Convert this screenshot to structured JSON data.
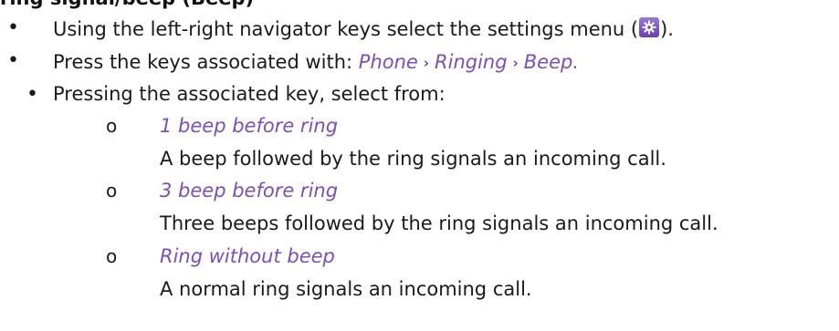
{
  "heading_fragment": "ring signal/beep (Beep)",
  "bullets": [
    {
      "pre": "Using the left-right navigator keys select the settings menu (",
      "post": ")."
    },
    {
      "pre": "Press the keys associated with: ",
      "path": [
        "Phone",
        "Ringing",
        "Beep"
      ],
      "post": "."
    },
    {
      "text": "Pressing the associated key, select from:"
    }
  ],
  "chevron": "›",
  "options": [
    {
      "name": "1 beep before ring",
      "desc": "A beep followed by the ring signals an incoming call."
    },
    {
      "name": "3 beep before ring",
      "desc": "Three beeps followed by the ring signals an incoming call."
    },
    {
      "name": "Ring without beep",
      "desc": "A normal ring signals an incoming call."
    }
  ],
  "icons": {
    "settings": "gear-icon",
    "bullet": "•",
    "sub_bullet": "o"
  },
  "colors": {
    "accent": "#7d4fb4",
    "icon_bg": "#6a3fb0"
  }
}
